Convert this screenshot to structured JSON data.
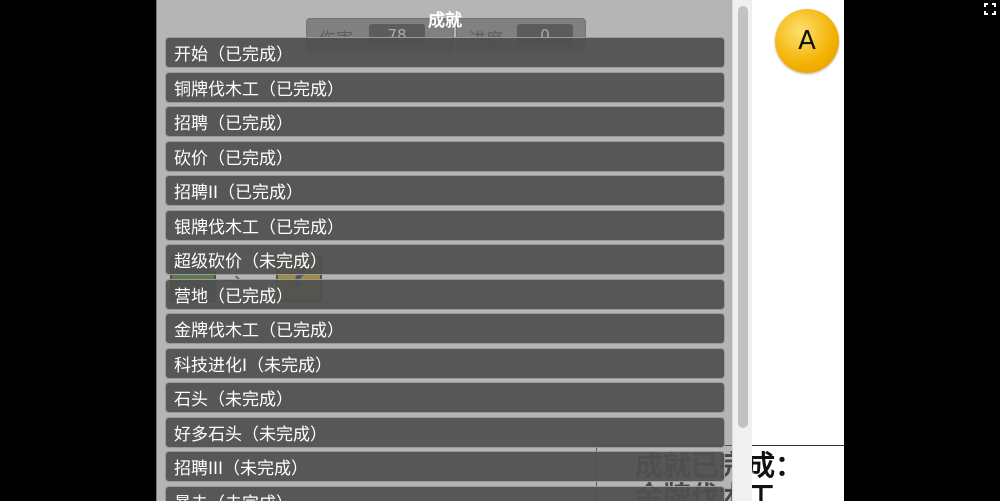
{
  "hud": {
    "damage_label": "伤害",
    "damage_value": "78",
    "progress_label": "进度",
    "progress_value": "0"
  },
  "panel": {
    "title": "成就",
    "items": [
      {
        "label": "开始（已完成）"
      },
      {
        "label": "铜牌伐木工（已完成）"
      },
      {
        "label": "招聘（已完成）"
      },
      {
        "label": "砍价（已完成）"
      },
      {
        "label": "招聘II（已完成）"
      },
      {
        "label": "银牌伐木工（已完成）"
      },
      {
        "label": "超级砍价（未完成）"
      },
      {
        "label": "营地（已完成）"
      },
      {
        "label": "金牌伐木工（已完成）"
      },
      {
        "label": "科技进化I（未完成）"
      },
      {
        "label": "石头（未完成）"
      },
      {
        "label": "好多石头（未完成）"
      },
      {
        "label": "招聘III（未完成）"
      },
      {
        "label": "暴击（未完成）"
      }
    ]
  },
  "game": {
    "arrow": "→",
    "mystery_glyph": "?"
  },
  "toast": {
    "title": "成就已完成：",
    "subtitle": "金牌伐木工"
  },
  "controls": {
    "a_button_label": "A"
  },
  "icons": {
    "fullscreen": "fullscreen-icon",
    "a_button": "a-button"
  },
  "colors": {
    "a_button": "#f2b100",
    "panel_item_bg": "#505050"
  }
}
